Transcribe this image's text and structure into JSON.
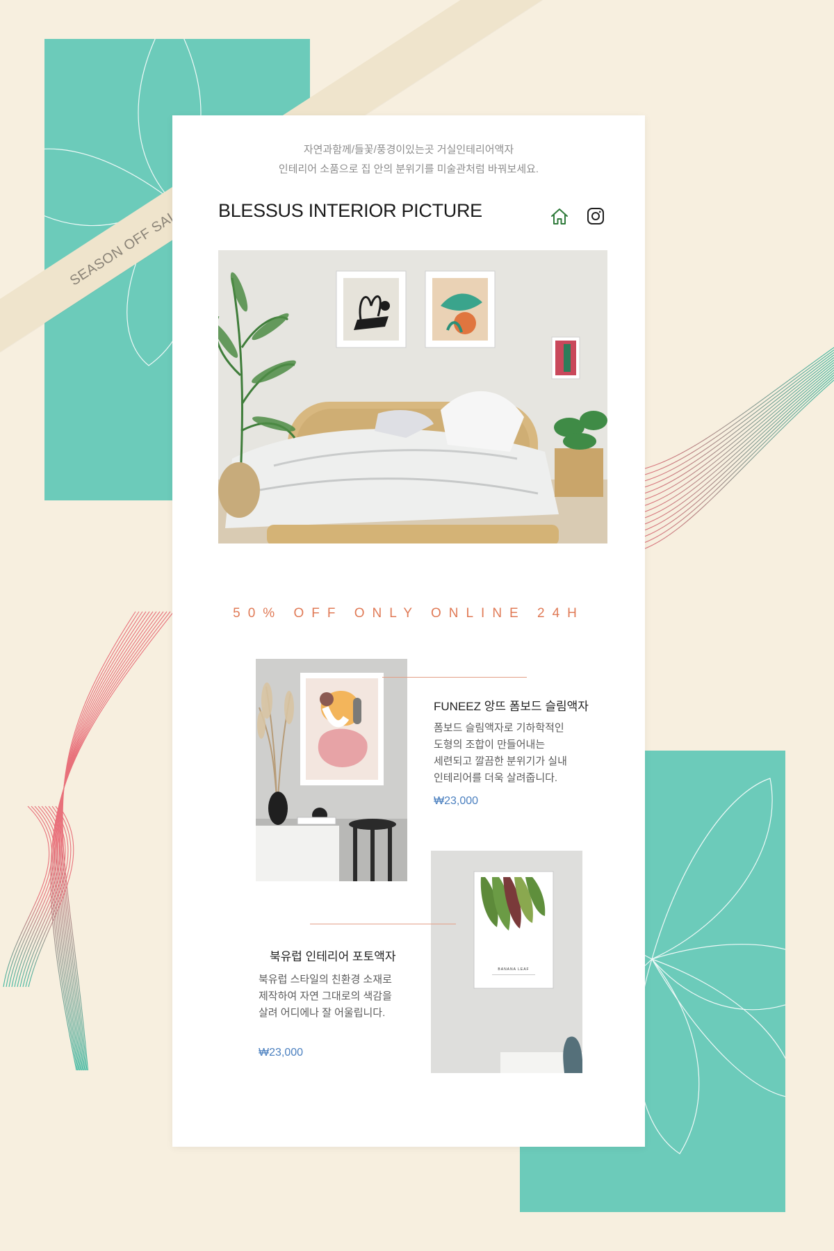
{
  "ribbon": {
    "text": "SEASON OFF SALE PROMOTION"
  },
  "header": {
    "subtitle_line1": "자연과함께/들꽃/풍경이있는곳 거실인테리어액자",
    "subtitle_line2": "인테리어 소품으로 집 안의 분위기를 미술관처럼 바꿔보세요.",
    "title": "BLESSUS INTERIOR PICTURE",
    "icons": [
      "home-icon",
      "instagram-icon"
    ]
  },
  "promo": {
    "text": "50% OFF ONLY ONLINE 24H"
  },
  "products": [
    {
      "name": "FUNEEZ 앙뜨 폼보드 슬림액자",
      "description": [
        "폼보드 슬림액자로 기하학적인",
        "도형의 조합이 만들어내는",
        "세련되고 깔끔한 분위기가 실내",
        "인테리어를 더욱 살려줍니다."
      ],
      "price": "₩23,000"
    },
    {
      "name": "북유럽 인테리어 포토액자",
      "description": [
        "북유럽 스타일의 친환경 소재로",
        "제작하여 자연 그대로의 색감을",
        "살려 어디에나 잘 어울립니다."
      ],
      "price": "₩23,000",
      "poster_caption": "BANANA LEAF"
    }
  ],
  "colors": {
    "background": "#f7efdf",
    "teal": "#6ccbba",
    "accent_orange": "#e07a56",
    "price_blue": "#4a7fbf"
  }
}
